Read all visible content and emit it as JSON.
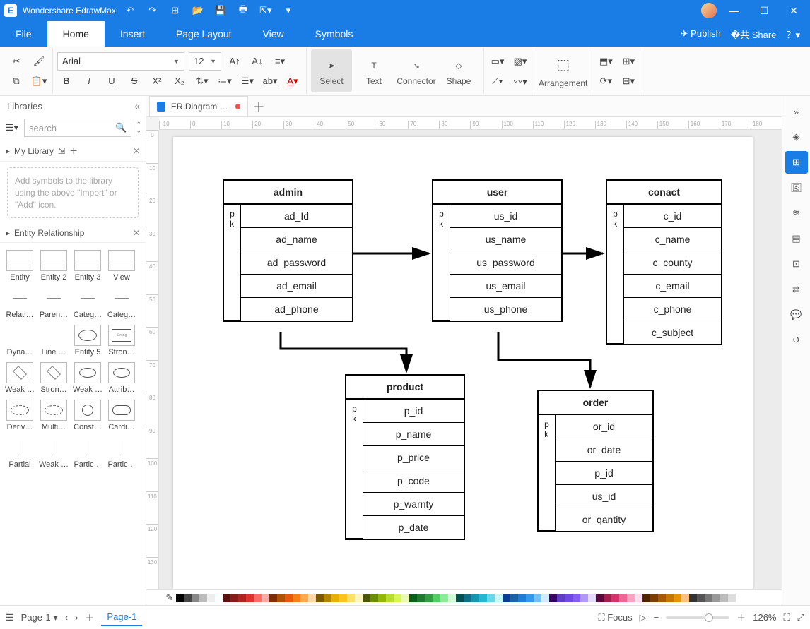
{
  "app": {
    "title": "Wondershare EdrawMax"
  },
  "window": {
    "min": "—",
    "max": "☐",
    "close": "✕"
  },
  "topbar_actions": {
    "publish": "Publish",
    "share": "Share"
  },
  "menu": {
    "tabs": [
      "File",
      "Home",
      "Insert",
      "Page Layout",
      "View",
      "Symbols"
    ],
    "active": "Home"
  },
  "ribbon": {
    "font_name": "Arial",
    "font_size": "12",
    "tools": {
      "select": "Select",
      "text": "Text",
      "connector": "Connector",
      "shape": "Shape",
      "arrangement": "Arrangement"
    }
  },
  "libraries": {
    "header": "Libraries",
    "search_placeholder": "search",
    "mylib": "My Library",
    "mylib_hint": "Add symbols to the library using the above \"Import\" or \"Add\" icon.",
    "section": "Entity Relationship",
    "shapes": [
      [
        "Entity",
        "Entity 2",
        "Entity 3",
        "View"
      ],
      [
        "Relati…",
        "Paren…",
        "Categ…",
        "Categ…"
      ],
      [
        "Dyna…",
        "Line …",
        "Entity 5",
        "Stron…"
      ],
      [
        "Weak …",
        "Stron…",
        "Weak …",
        "Attrib…"
      ],
      [
        "Deriv…",
        "Multi…",
        "Const…",
        "Cardi…"
      ],
      [
        "Partial",
        "Weak …",
        "Partic…",
        "Partic…"
      ]
    ]
  },
  "doc": {
    "tab_title": "ER Diagram for …"
  },
  "entities": {
    "admin": {
      "title": "admin",
      "pk": "pk",
      "attrs": [
        "ad_Id",
        "ad_name",
        "ad_password",
        "ad_email",
        "ad_phone"
      ]
    },
    "user": {
      "title": "user",
      "pk": "pk",
      "attrs": [
        "us_id",
        "us_name",
        "us_password",
        "us_email",
        "us_phone"
      ]
    },
    "conact": {
      "title": "conact",
      "pk": "pk",
      "attrs": [
        "c_id",
        "c_name",
        "c_county",
        "c_email",
        "c_phone",
        "c_subject"
      ]
    },
    "product": {
      "title": "product",
      "pk": "pk",
      "attrs": [
        "p_id",
        "p_name",
        "p_price",
        "p_code",
        "p_warnty",
        "p_date"
      ]
    },
    "order": {
      "title": "order",
      "pk": "pk",
      "attrs": [
        "or_id",
        "or_date",
        "p_id",
        "us_id",
        "or_qantity"
      ]
    }
  },
  "status": {
    "page_dropdown": "Page-1",
    "page_tab": "Page-1",
    "focus": "Focus",
    "zoom": "126%"
  },
  "palette": [
    "#000",
    "#444",
    "#888",
    "#bbb",
    "#eee",
    "#fff",
    "#5b0f0f",
    "#8b1a1a",
    "#b22222",
    "#e03131",
    "#ff6b6b",
    "#ffa8a8",
    "#7f2d00",
    "#b35000",
    "#e8590c",
    "#fd7e14",
    "#ffa94d",
    "#ffd8a8",
    "#7a5900",
    "#b38600",
    "#e6b000",
    "#fcc419",
    "#ffe066",
    "#fff3bf",
    "#4b5800",
    "#6b8e00",
    "#94b800",
    "#b7dd29",
    "#d8f556",
    "#eafab0",
    "#0b5d1e",
    "#1c7c32",
    "#2f9e44",
    "#51cf66",
    "#8ce99a",
    "#d3f9d8",
    "#065052",
    "#0b7285",
    "#1098ad",
    "#22b8cf",
    "#66d9e8",
    "#c5f6fa",
    "#0b3d91",
    "#1864ab",
    "#1c7ed6",
    "#339af0",
    "#74c0fc",
    "#d0ebff",
    "#3b0764",
    "#5f3dc4",
    "#7048e8",
    "#845ef7",
    "#b197fc",
    "#e5dbff",
    "#5c0a3d",
    "#a61e4d",
    "#d6336c",
    "#f06595",
    "#faa2c1",
    "#ffdeeb",
    "#4d2600",
    "#7a3e00",
    "#a65a00",
    "#c77700",
    "#e69500",
    "#ffc078",
    "#333",
    "#555",
    "#777",
    "#999",
    "#bbb",
    "#ddd",
    "#fff"
  ]
}
